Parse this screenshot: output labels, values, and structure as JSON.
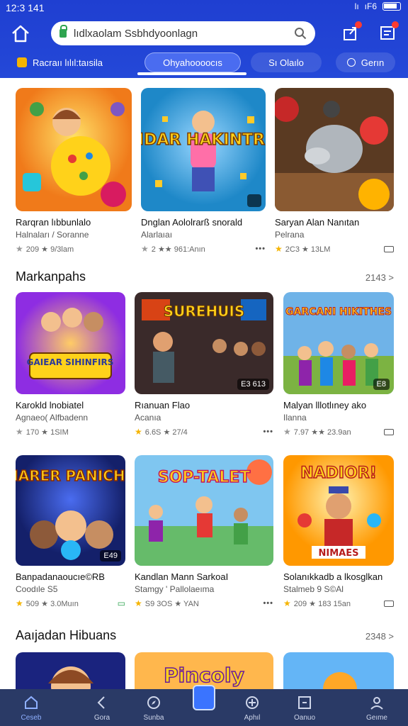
{
  "status": {
    "time": "12:3 141",
    "signal": "lı",
    "network": "ıF6"
  },
  "search": {
    "value": "lıdlxaolam Ssbhdyoonlagn",
    "placeholder": ""
  },
  "chips": [
    {
      "label": "Racraıı lılıl:taısila"
    },
    {
      "label": "Ohyahoooocıs"
    },
    {
      "label": "Sı Olaılo"
    },
    {
      "label": "Gerın"
    }
  ],
  "row1": [
    {
      "title": "Rarqran lıbbunlalo",
      "sub": "Halnaları / Soranne",
      "meta": "209 ★ 9/3lam"
    },
    {
      "title": "Dnglan Aololrarß snorald",
      "sub": "Alarlaıaı",
      "meta": "2 ★★ 961:Anın"
    },
    {
      "title": "Saryan Alan Nanıtan",
      "sub": "Pelrana",
      "meta": "2C3 ★ 13LM"
    }
  ],
  "section1": {
    "title": "Markanpahs",
    "count": "2143 >"
  },
  "row2": [
    {
      "title": "Karokld lnobiatel",
      "sub": "Agnaeo( Alfbadenn",
      "meta": "170 ★ 1SIM",
      "badge": ""
    },
    {
      "title": "Rıanuan Flao",
      "sub": "Acanıa",
      "meta": "6.6S ★ 27/4",
      "badge": "E3 613"
    },
    {
      "title": "Malyan lllotlıney ako",
      "sub": "Ilanna",
      "meta": "7.97 ★★ 23.9an",
      "badge": "E8"
    }
  ],
  "row3": [
    {
      "title": "Banpadanaoucıe©RB",
      "sub": "Coodıle S5",
      "meta": "509 ★ 3.0Muın",
      "badge": "E49"
    },
    {
      "title": "Kandlan Mann SarkoaI",
      "sub": "Stamgy ' Pallolaeıma",
      "meta": "S9 3OS ★ YAN",
      "badge": ""
    },
    {
      "title": "Solanıkkadb a lkosglkan",
      "sub": "Stalmeb 9 S©Al",
      "meta": "209 ★ 183 15an",
      "badge": ""
    }
  ],
  "section2": {
    "title": "Aaıjadan Hibuans",
    "count": "2348 >"
  },
  "thumbs": {
    "r2c1": "GAIEAR SIHINFIRS",
    "r2c2": "SUREHUIS",
    "r2c3": "GARCANI HIKITHES",
    "r3c1": "HARER PANICHS",
    "r3c2": "SOP-TALET",
    "r3c3": "NADIOR!",
    "r3c3b": "NIMAES",
    "r1c2": "RANDAR HAKINTRENS",
    "r4c2": "Pincoly"
  },
  "nav": [
    {
      "label": "Ceseb"
    },
    {
      "label": "Gora"
    },
    {
      "label": "Sunba"
    },
    {
      "label": ""
    },
    {
      "label": "Aphıl"
    },
    {
      "label": "Oanuo"
    },
    {
      "label": "Geıme"
    }
  ],
  "colors": {
    "brand": "#2448d8",
    "nav": "#2a3a66",
    "star": "#f5b400"
  }
}
